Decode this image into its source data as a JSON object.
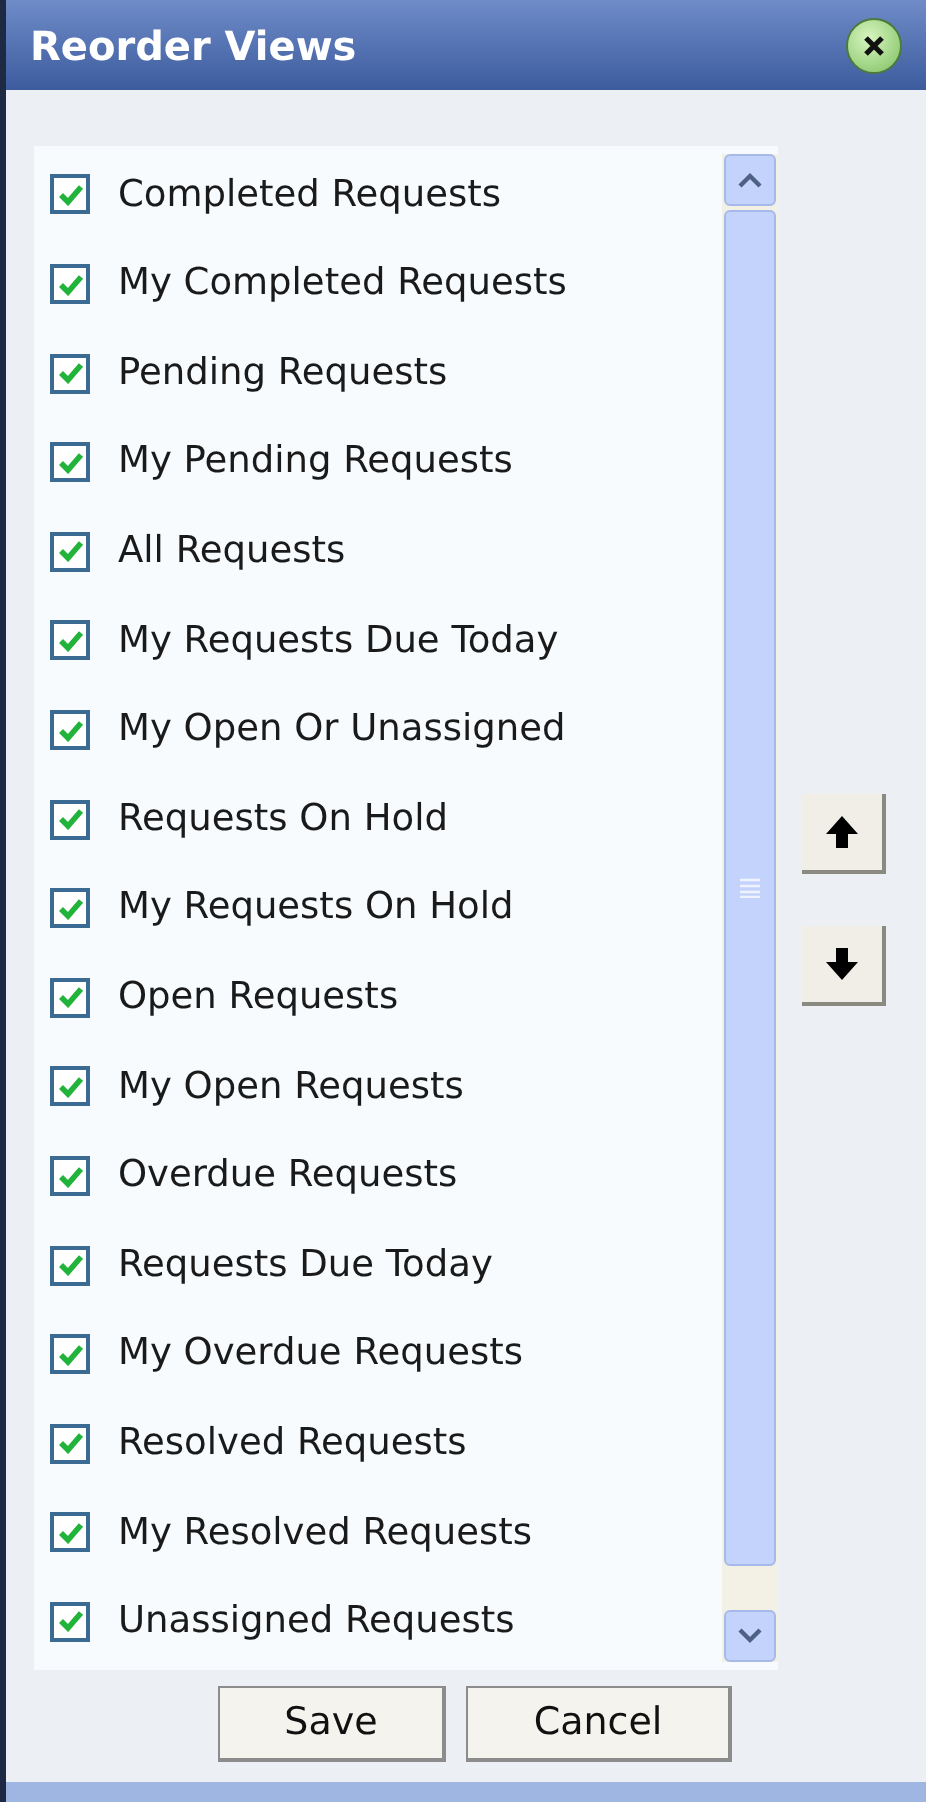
{
  "window": {
    "title": "Reorder Views"
  },
  "views": [
    {
      "label": "Completed Requests",
      "checked": true
    },
    {
      "label": "My Completed Requests",
      "checked": true
    },
    {
      "label": "Pending Requests",
      "checked": true
    },
    {
      "label": "My Pending Requests",
      "checked": true
    },
    {
      "label": "All Requests",
      "checked": true
    },
    {
      "label": "My Requests Due Today",
      "checked": true
    },
    {
      "label": "My Open Or Unassigned",
      "checked": true
    },
    {
      "label": "Requests On Hold",
      "checked": true
    },
    {
      "label": "My Requests On Hold",
      "checked": true
    },
    {
      "label": "Open Requests",
      "checked": true
    },
    {
      "label": "My Open Requests",
      "checked": true
    },
    {
      "label": "Overdue Requests",
      "checked": true
    },
    {
      "label": "Requests Due Today",
      "checked": true
    },
    {
      "label": "My Overdue Requests",
      "checked": true
    },
    {
      "label": "Resolved Requests",
      "checked": true
    },
    {
      "label": "My Resolved Requests",
      "checked": true
    },
    {
      "label": "Unassigned Requests",
      "checked": true
    }
  ],
  "buttons": [
    "Save",
    "Cancel"
  ]
}
